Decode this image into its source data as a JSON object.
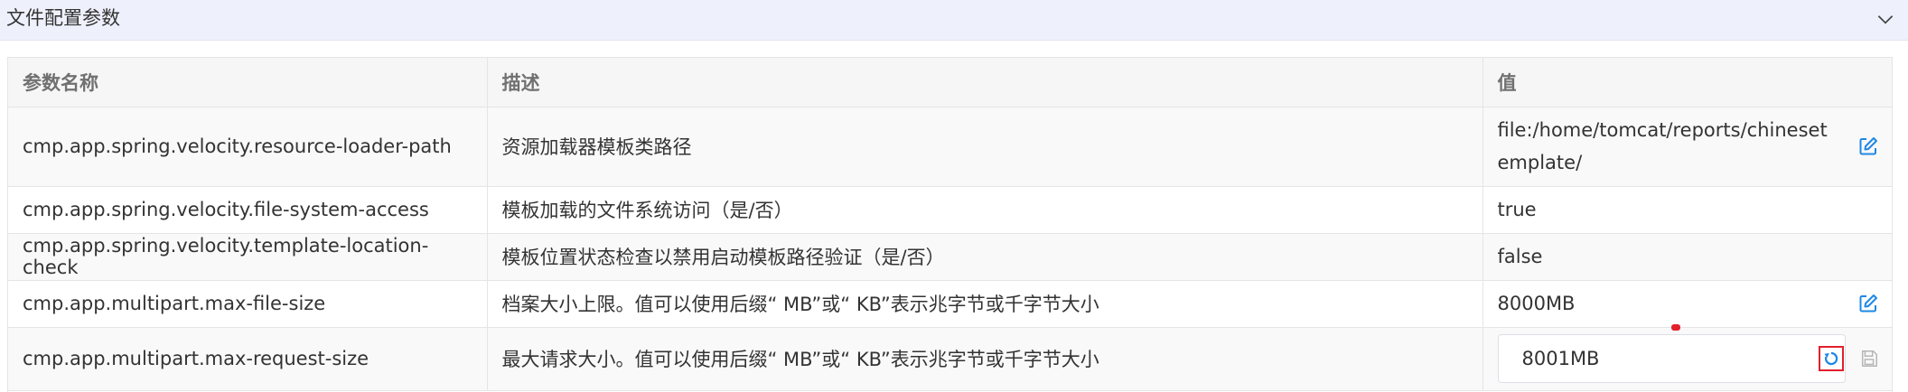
{
  "panel": {
    "title": "文件配置参数",
    "collapse_icon": "chevron-down-icon"
  },
  "table": {
    "headers": [
      "参数名称",
      "描述",
      "值"
    ],
    "rows": [
      {
        "name": "cmp.app.spring.velocity.resource-loader-path",
        "description": "资源加载器模板类路径",
        "value": "file:/home/tomcat/reports/chinesetemplate/",
        "action_icon": "edit-icon"
      },
      {
        "name": "cmp.app.spring.velocity.file-system-access",
        "description": "模板加载的文件系统访问（是/否）",
        "value": "true"
      },
      {
        "name": "cmp.app.spring.velocity.template-location-check",
        "description": "模板位置状态检查以禁用启动模板路径验证（是/否）",
        "value": "false"
      },
      {
        "name": "cmp.app.multipart.max-file-size",
        "description": "档案大小上限。值可以使用后缀“ MB”或“ KB”表示兆字节或千字节大小",
        "value": "8000MB",
        "action_icon": "edit-icon"
      },
      {
        "name": "cmp.app.multipart.max-request-size",
        "description": "最大请求大小。值可以使用后缀“ MB”或“ KB”表示兆字节或千字节大小",
        "input_value": "8001MB",
        "reset_icon": "reset-icon",
        "save_icon": "save-icon"
      }
    ]
  },
  "colors": {
    "header_bg": "#eef0fb",
    "accent_blue": "#1e88e5",
    "highlight_red": "#e3202d"
  }
}
